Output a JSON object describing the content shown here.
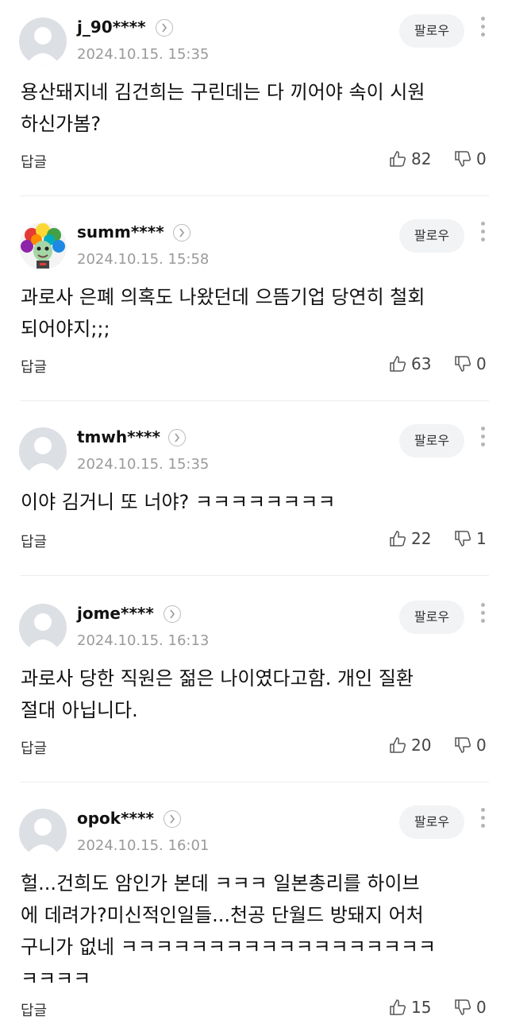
{
  "comments": [
    {
      "username": "j_90****",
      "date": "2024.10.15. 15:35",
      "follow": "팔로우",
      "text": "용산돼지네 김건희는 구린데는 다 끼어야 속이 시원\n하신가봄?",
      "reply": "답글",
      "likes": "82",
      "dislikes": "0",
      "avatar": "default"
    },
    {
      "username": "summ****",
      "date": "2024.10.15. 15:58",
      "follow": "팔로우",
      "text": "과로사 은폐 의혹도 나왔던데 으뜸기업 당연히 철회\n되어야지;;;",
      "reply": "답글",
      "likes": "63",
      "dislikes": "0",
      "avatar": "rainbow-afro-character"
    },
    {
      "username": "tmwh****",
      "date": "2024.10.15. 15:35",
      "follow": "팔로우",
      "text": "이야 김거니 또 너야? ㅋㅋㅋㅋㅋㅋㅋㅋ",
      "reply": "답글",
      "likes": "22",
      "dislikes": "1",
      "avatar": "default"
    },
    {
      "username": "jome****",
      "date": "2024.10.15. 16:13",
      "follow": "팔로우",
      "text": "과로사 당한 직원은 젊은 나이였다고함. 개인 질환\n절대 아닙니다.",
      "reply": "답글",
      "likes": "20",
      "dislikes": "0",
      "avatar": "default"
    },
    {
      "username": "opok****",
      "date": "2024.10.15. 16:01",
      "follow": "팔로우",
      "text": "헐...건희도 암인가 본데 ㅋㅋㅋ 일본총리를 하이브\n에 데려가?미신적인일들...천공 단월드 방돼지 어처\n구니가 없네 ㅋㅋㅋㅋㅋㅋㅋㅋㅋㅋㅋㅋㅋㅋㅋㅋㅋㅋ\nㅋㅋㅋㅋ",
      "reply": "답글",
      "likes": "15",
      "dislikes": "0",
      "avatar": "default"
    }
  ]
}
